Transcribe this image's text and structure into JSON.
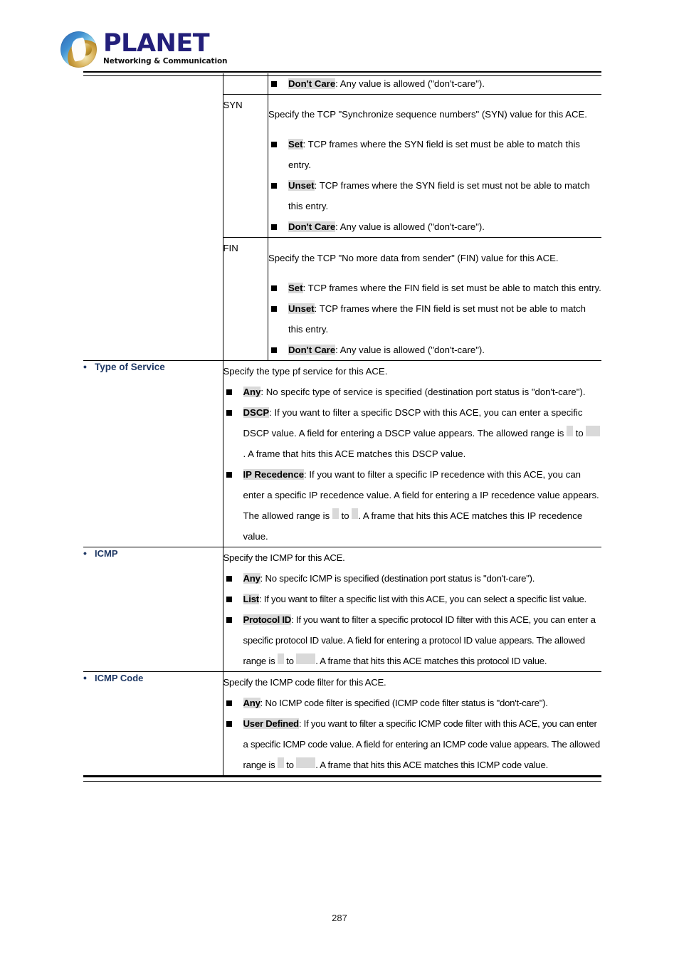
{
  "brand": {
    "wordmark": "PLANET",
    "tagline": "Networking & Communication"
  },
  "footer": {
    "page_number": "287"
  },
  "colors": {
    "label_blue": "#1f3864",
    "highlight_gray": "#d9d9d9",
    "logo_navy": "#231f7a"
  },
  "table": {
    "flag_rows": [
      {
        "key": "",
        "intro": "",
        "bullets": [
          {
            "term": "Don't Care",
            "rest": ": Any value is allowed (\"don't-care\")."
          }
        ]
      },
      {
        "key": "SYN",
        "intro": "Specify the TCP \"Synchronize sequence numbers\" (SYN) value for this ACE.",
        "bullets": [
          {
            "term": "Set",
            "rest": ": TCP frames where the SYN field is set must be able to match this entry."
          },
          {
            "term": "Unset",
            "rest": ": TCP frames where the SYN field is set must not be able to match this entry."
          },
          {
            "term": "Don't Care",
            "rest": ": Any value is allowed (\"don't-care\")."
          }
        ]
      },
      {
        "key": "FIN",
        "intro": "Specify the TCP \"No more data from sender\" (FIN) value for this ACE.",
        "bullets": [
          {
            "term": "Set",
            "rest": ": TCP frames where the FIN field is set must be able to match this entry."
          },
          {
            "term": "Unset",
            "rest": ": TCP frames where the FIN field is set must not be able to match this entry."
          },
          {
            "term": "Don't Care",
            "rest": ": Any value is allowed (\"don't-care\")."
          }
        ]
      }
    ],
    "tos": {
      "label": "Type of Service",
      "intro": "Specify the type pf service for this ACE.",
      "b1_term": "Any",
      "b1_rest": ": No specifc type of service is specified (destination port status is \"don't-care\").",
      "b2_term": "DSCP",
      "b2_a": ": If you want to filter a specific DSCP with this ACE, you can enter a specific DSCP value. A field for entering a DSCP value appears. The allowed range is",
      "b2_to": "to",
      "b2_b": ". A frame that hits this ACE matches this DSCP value.",
      "b3_term": "IP Recedence",
      "b3_a": ": If you want to filter a specific IP recedence with this ACE, you can enter a specific IP recedence value. A field for entering a IP recedence value appears. The allowed range is",
      "b3_to": "to",
      "b3_b": ". A frame that hits this ACE matches this IP recedence value."
    },
    "icmp": {
      "label": "ICMP",
      "intro": "Specify the ICMP for this ACE.",
      "b1_term": "Any",
      "b1_rest": ": No specifc ICMP is specified (destination port status is \"don't-care\").",
      "b2_term": "List",
      "b2_rest": ": If you want to filter a specific list with this ACE, you can select a specific list value.",
      "b3_term": "Protocol ID",
      "b3_a": ": If you want to filter a specific protocol ID filter with this ACE, you can enter a specific protocol ID value. A field for entering a protocol ID value appears. The allowed range is",
      "b3_to": "to",
      "b3_b": ". A frame that hits this ACE matches this protocol ID value."
    },
    "icmp_code": {
      "label": "ICMP Code",
      "intro": "Specify the ICMP code filter for this ACE.",
      "b1_term": "Any",
      "b1_rest": ": No ICMP code filter is specified (ICMP code filter status is \"don't-care\").",
      "b2_term": "User Defined",
      "b2_a": ": If you want to filter a specific ICMP code filter with this ACE, you can enter a specific ICMP code value. A field for entering an ICMP code value appears. The allowed range is",
      "b2_to": "to",
      "b2_b": ". A frame that hits this ACE matches this ICMP code value."
    }
  }
}
